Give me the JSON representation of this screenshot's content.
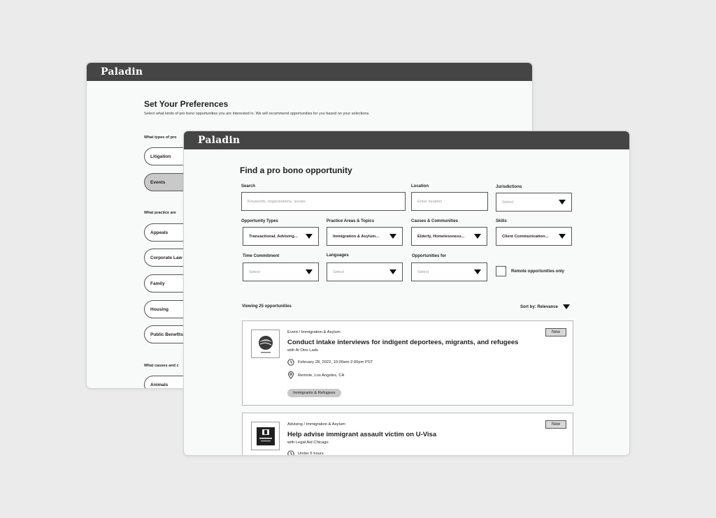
{
  "back_window": {
    "logo": "Paladin",
    "title": "Set Your Preferences",
    "subtitle": "Select what kinds of pro bono opportunities you are interested in. We will recommend opportunities for you based on your selections.",
    "q_types": "What types of pro",
    "types": [
      {
        "label": "Litigation",
        "selected": false
      },
      {
        "label": "Events",
        "selected": true
      }
    ],
    "q_practice": "What practice are",
    "practice_areas": [
      {
        "label": "Appeals"
      },
      {
        "label": "Corporate Law"
      },
      {
        "label": "Family"
      },
      {
        "label": "Housing"
      },
      {
        "label": "Public Benefits &"
      }
    ],
    "q_causes": "What causes and c",
    "causes": [
      {
        "label": "Animals"
      }
    ]
  },
  "front_window": {
    "logo": "Paladin",
    "title": "Find a pro bono opportunity",
    "filters": {
      "search": {
        "label": "Search",
        "placeholder": "Keywords, organizations, issues"
      },
      "location": {
        "label": "Location",
        "placeholder": "Enter location"
      },
      "jurisdictions": {
        "label": "Jurisdictions",
        "placeholder": "Select"
      },
      "opportunity_types": {
        "label": "Opportunity Types",
        "value": "Transactional, Advising..."
      },
      "practice_areas": {
        "label": "Practice Areas & Topics",
        "value": "Immigration & Asylum..."
      },
      "causes": {
        "label": "Causes & Communities",
        "value": "Elderly, Homelessness..."
      },
      "skills": {
        "label": "Skills",
        "value": "Client Communication..."
      },
      "time_commitment": {
        "label": "Time Commitment",
        "placeholder": "Select"
      },
      "languages": {
        "label": "Languages",
        "placeholder": "Select"
      },
      "opportunities_for": {
        "label": "Opportunities for",
        "placeholder": "Select"
      },
      "remote_only": {
        "label": "Remote opportunities only",
        "checked": false
      }
    },
    "results": {
      "count_text": "Viewing 25 opportunities",
      "sort_text": "Sort by: Relevance"
    },
    "cards": [
      {
        "crumb": "Event / Immigration & Asylum",
        "title": "Conduct intake interviews for indigent deportees, migrants, and refugees",
        "org": "with Al Otro Lado",
        "date": "February 28, 2022, 10:00am-2:00pm PST",
        "location": "Remote, Los Angeles, CA",
        "tag": "Immigrants & Refugees",
        "badge": "New",
        "thumb_icon": "al-otro-lado-logo"
      },
      {
        "crumb": "Advising / Immigration & Asylum",
        "title": "Help advise immigrant assault victim on U-Visa",
        "org": "with Legal Aid Chicago",
        "time": "Under 5 hours",
        "badge": "New",
        "thumb_icon": "legal-aid-chicago-logo"
      }
    ]
  }
}
